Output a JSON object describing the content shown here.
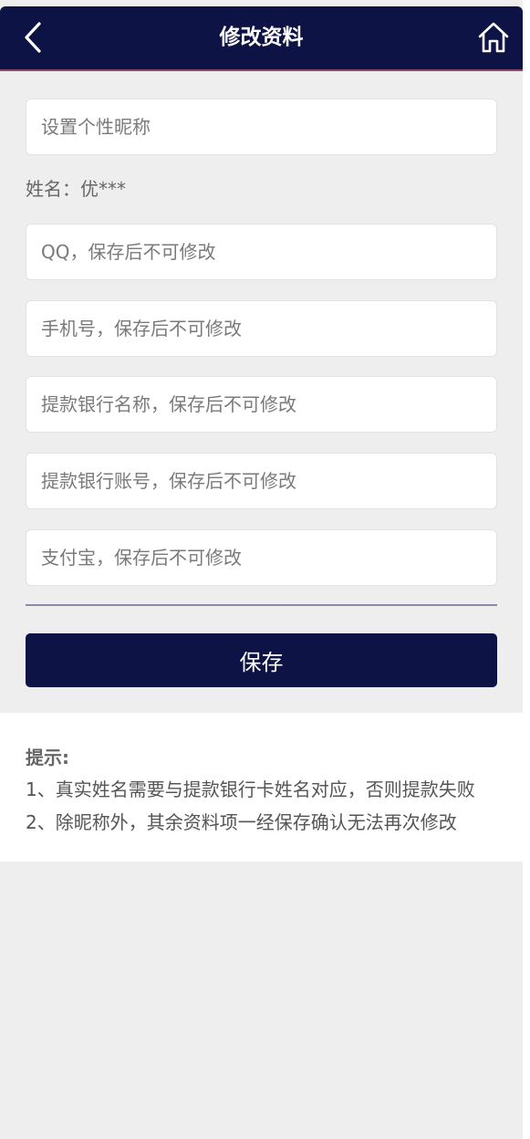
{
  "header": {
    "title": "修改资料"
  },
  "form": {
    "nickname_placeholder": "设置个性昵称",
    "name_label": "姓名：",
    "name_value": "优***",
    "qq_placeholder": "QQ，保存后不可修改",
    "phone_placeholder": "手机号，保存后不可修改",
    "bank_name_placeholder": "提款银行名称，保存后不可修改",
    "bank_account_placeholder": "提款银行账号，保存后不可修改",
    "alipay_placeholder": "支付宝，保存后不可修改",
    "save_label": "保存"
  },
  "tips": {
    "title": "提示:",
    "lines": [
      "1、真实姓名需要与提款银行卡姓名对应，否则提款失败",
      "2、除昵称外，其余资料项一经保存确认无法再次修改"
    ]
  },
  "icons": {
    "back": "chevron-left-icon",
    "home": "home-icon"
  },
  "colors": {
    "header_bg": "#0d1344",
    "button_bg": "#0d1344",
    "page_bg": "#eeeeee"
  }
}
